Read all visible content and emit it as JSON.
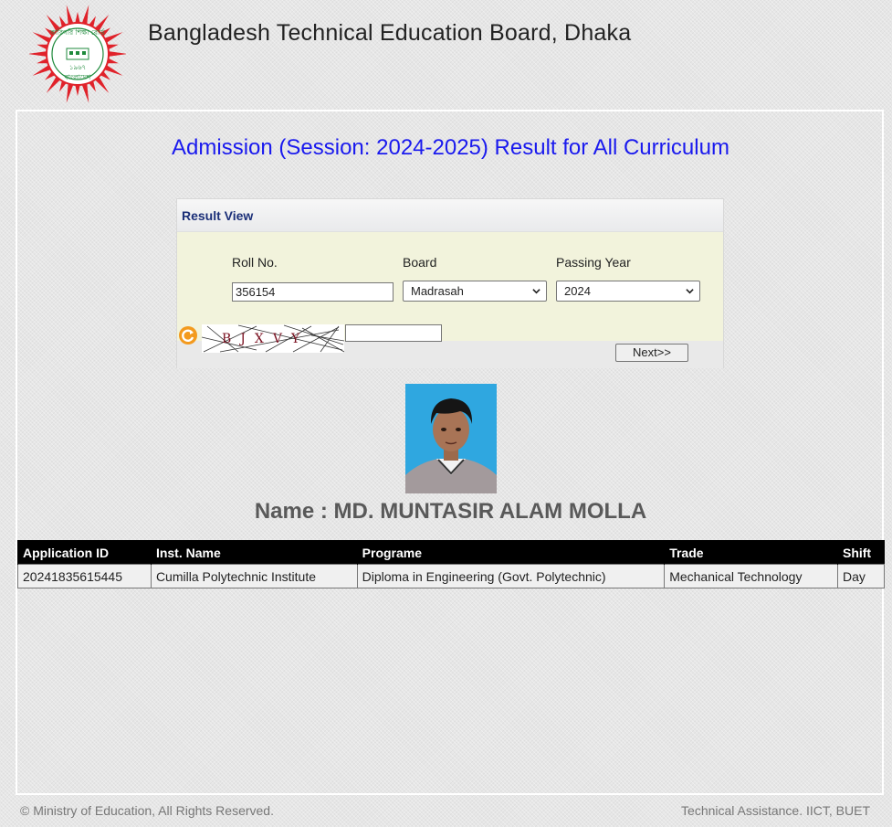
{
  "header": {
    "site_title": "Bangladesh Technical Education Board, Dhaka",
    "logo": {
      "icon": "btbe-emblem-icon",
      "text_top": "কারিগরি শিক্ষা বোর্ড",
      "text_year": "১৯৬৭",
      "text_bottom": "বাংলাদেশ",
      "colors": {
        "sunburst": "#e0222a",
        "text": "#1f8a3c"
      }
    }
  },
  "main": {
    "title": "Admission (Session: 2024-2025) Result for All Curriculum"
  },
  "form": {
    "panel_title": "Result View",
    "roll_label": "Roll No.",
    "roll_value": "356154",
    "board_label": "Board",
    "board_selected": "Madrasah",
    "year_label": "Passing Year",
    "year_selected": "2024",
    "captcha_text": "BJXVY",
    "captcha_value": "",
    "refresh_icon": "refresh-icon",
    "next_label": "Next>>"
  },
  "student": {
    "photo_icon": "student-photo",
    "name_text": "Name : MD. MUNTASIR ALAM MOLLA"
  },
  "result_table": {
    "headers": [
      "Application ID",
      "Inst. Name",
      "Programe",
      "Trade",
      "Shift"
    ],
    "rows": [
      [
        "20241835615445",
        "Cumilla Polytechnic Institute",
        "Diploma in Engineering (Govt. Polytechnic)",
        "Mechanical Technology",
        "Day"
      ]
    ]
  },
  "footer": {
    "left": "© Ministry of Education, All Rights Reserved.",
    "right": "Technical Assistance. IICT, BUET"
  },
  "colors": {
    "title_blue": "#1a1aee",
    "panel_title": "#1b2f78",
    "table_header_bg": "#000000",
    "refresh_orange": "#f39a1e"
  }
}
